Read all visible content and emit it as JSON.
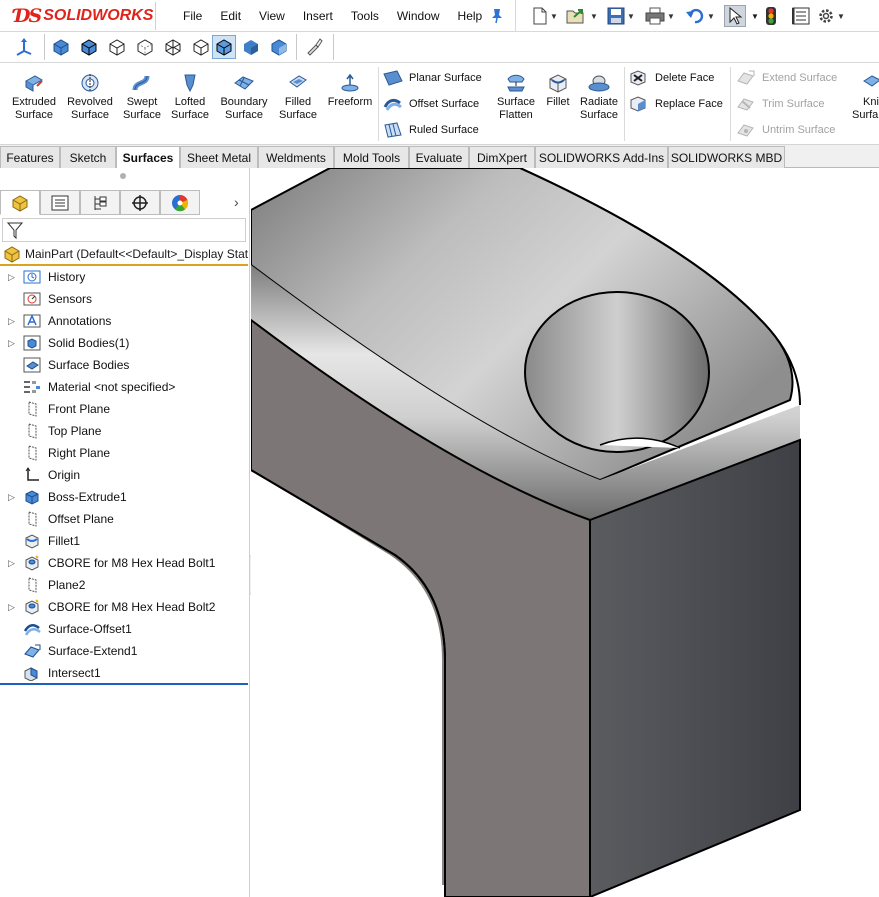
{
  "app": {
    "brand": "SOLIDWORKS"
  },
  "menu": [
    "File",
    "Edit",
    "View",
    "Insert",
    "Tools",
    "Window",
    "Help"
  ],
  "quick_access": [
    "new-icon",
    "open-icon",
    "save-icon",
    "print-icon",
    "undo-icon",
    "select-icon",
    "rebuild-icon",
    "file-properties-icon",
    "options-icon"
  ],
  "ribbon": {
    "tools": [
      {
        "label": "Extruded Surface",
        "line1": "Extruded",
        "line2": "Surface",
        "icon": "extruded-surface-icon"
      },
      {
        "label": "Revolved Surface",
        "line1": "Revolved",
        "line2": "Surface",
        "icon": "revolved-surface-icon"
      },
      {
        "label": "Swept Surface",
        "line1": "Swept",
        "line2": "Surface",
        "icon": "swept-surface-icon"
      },
      {
        "label": "Lofted Surface",
        "line1": "Lofted",
        "line2": "Surface",
        "icon": "lofted-surface-icon"
      },
      {
        "label": "Boundary Surface",
        "line1": "Boundary",
        "line2": "Surface",
        "icon": "boundary-surface-icon"
      },
      {
        "label": "Filled Surface",
        "line1": "Filled",
        "line2": "Surface",
        "icon": "filled-surface-icon"
      },
      {
        "label": "Freeform",
        "line1": "Freeform",
        "line2": "",
        "icon": "freeform-icon"
      }
    ],
    "surface_group": [
      "Planar Surface",
      "Offset Surface",
      "Ruled Surface"
    ],
    "surface_flatten": {
      "line1": "Surface",
      "line2": "Flatten"
    },
    "fillet": "Fillet",
    "radiate": {
      "line1": "Radiate",
      "line2": "Surface"
    },
    "face_group": [
      "Delete Face",
      "Replace Face"
    ],
    "disabled_group": [
      "Extend Surface",
      "Trim Surface",
      "Untrim Surface"
    ],
    "knit": {
      "line1": "Kni",
      "line2": "Surfa"
    }
  },
  "command_tabs": [
    {
      "label": "Features",
      "active": false
    },
    {
      "label": "Sketch",
      "active": false
    },
    {
      "label": "Surfaces",
      "active": true
    },
    {
      "label": "Sheet Metal",
      "active": false
    },
    {
      "label": "Weldments",
      "active": false
    },
    {
      "label": "Mold Tools",
      "active": false
    },
    {
      "label": "Evaluate",
      "active": false
    },
    {
      "label": "DimXpert",
      "active": false
    },
    {
      "label": "SOLIDWORKS Add-Ins",
      "active": false
    },
    {
      "label": "SOLIDWORKS MBD",
      "active": false
    }
  ],
  "feature_tree": {
    "root": "MainPart  (Default<<Default>_Display Stat",
    "items": [
      {
        "label": "History",
        "expandable": true,
        "icon": "history-icon"
      },
      {
        "label": "Sensors",
        "expandable": false,
        "icon": "sensors-icon"
      },
      {
        "label": "Annotations",
        "expandable": true,
        "icon": "annotations-icon"
      },
      {
        "label": "Solid Bodies(1)",
        "expandable": true,
        "icon": "solid-bodies-icon"
      },
      {
        "label": "Surface Bodies",
        "expandable": false,
        "icon": "surface-bodies-icon"
      },
      {
        "label": "Material <not specified>",
        "expandable": false,
        "icon": "material-icon"
      },
      {
        "label": "Front Plane",
        "expandable": false,
        "icon": "plane-icon"
      },
      {
        "label": "Top Plane",
        "expandable": false,
        "icon": "plane-icon"
      },
      {
        "label": "Right Plane",
        "expandable": false,
        "icon": "plane-icon"
      },
      {
        "label": "Origin",
        "expandable": false,
        "icon": "origin-icon"
      },
      {
        "label": "Boss-Extrude1",
        "expandable": true,
        "icon": "boss-extrude-icon"
      },
      {
        "label": "Offset Plane",
        "expandable": false,
        "icon": "plane-icon"
      },
      {
        "label": "Fillet1",
        "expandable": false,
        "icon": "fillet-icon"
      },
      {
        "label": "CBORE for M8 Hex Head Bolt1",
        "expandable": true,
        "icon": "hole-wizard-icon"
      },
      {
        "label": "Plane2",
        "expandable": false,
        "icon": "plane-icon"
      },
      {
        "label": "CBORE for M8 Hex Head Bolt2",
        "expandable": true,
        "icon": "hole-wizard-icon"
      },
      {
        "label": "Surface-Offset1",
        "expandable": false,
        "icon": "offset-surface-icon"
      },
      {
        "label": "Surface-Extend1",
        "expandable": false,
        "icon": "extend-surface-icon"
      },
      {
        "label": "Intersect1",
        "expandable": false,
        "icon": "intersect-icon"
      }
    ]
  },
  "colors": {
    "accent_orange": "#d7a51e",
    "rollback_blue": "#1f5fbf",
    "brand_red": "#e2231a"
  }
}
